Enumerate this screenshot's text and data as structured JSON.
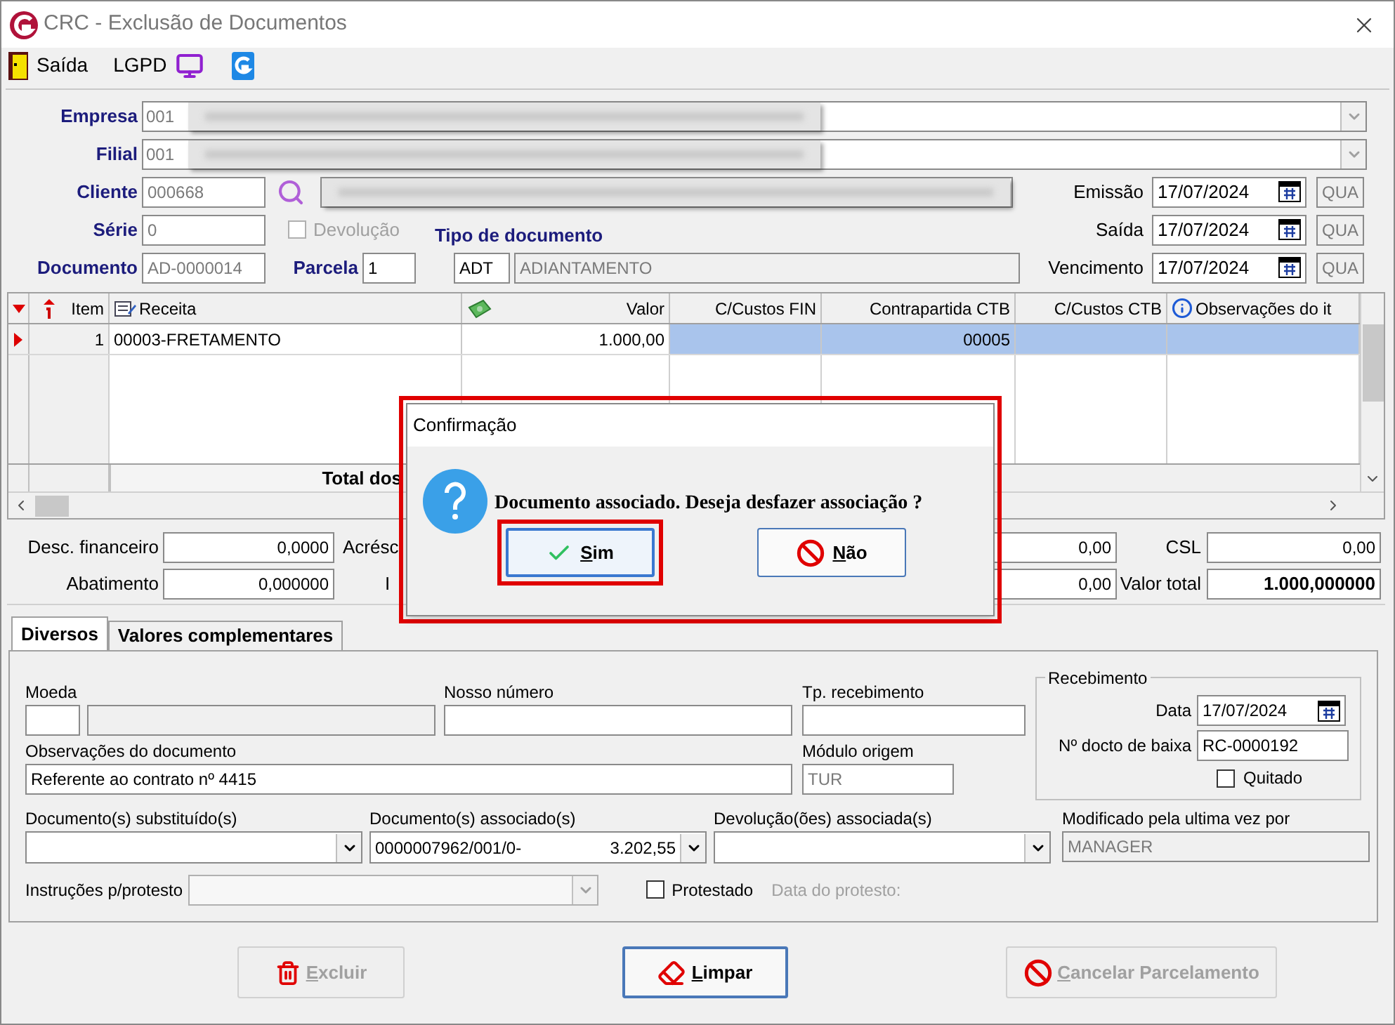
{
  "window": {
    "title": "CRC - Exclusão de Documentos"
  },
  "toolbar": [
    {
      "kind": "exit",
      "label": "Saída"
    },
    {
      "kind": "text",
      "label": "LGPD"
    },
    {
      "kind": "monitor"
    },
    {
      "kind": "logo"
    }
  ],
  "header": {
    "empresa": {
      "label": "Empresa",
      "code": "001"
    },
    "filial": {
      "label": "Filial",
      "code": "001"
    },
    "cliente": {
      "label": "Cliente",
      "code": "000668"
    },
    "serie": {
      "label": "Série",
      "value": "0"
    },
    "devolucao": {
      "label": "Devolução",
      "checked": false,
      "disabled": true
    },
    "documento": {
      "label": "Documento",
      "value": "AD-0000014"
    },
    "parcela": {
      "label": "Parcela",
      "value": "1"
    },
    "tipo": {
      "label": "Tipo de documento",
      "code": "ADT",
      "description": "ADIANTAMENTO"
    },
    "dates": [
      {
        "label": "Emissão",
        "value": "17/07/2024",
        "weekday": "QUA"
      },
      {
        "label": "Saída",
        "value": "17/07/2024",
        "weekday": "QUA"
      },
      {
        "label": "Vencimento",
        "value": "17/07/2024",
        "weekday": "QUA"
      }
    ]
  },
  "grid": {
    "columns": [
      {
        "label": "Item"
      },
      {
        "label": "Receita"
      },
      {
        "label": "Valor"
      },
      {
        "label": "C/Custos FIN"
      },
      {
        "label": "Contrapartida CTB"
      },
      {
        "label": "C/Custos CTB"
      },
      {
        "label": "Observações do it"
      }
    ],
    "rows": [
      {
        "selected": true,
        "cells": [
          "1",
          "00003-FRETAMENTO",
          "1.000,00",
          "",
          "00005",
          "",
          ""
        ]
      }
    ],
    "total_label": "Total dos"
  },
  "totals": [
    {
      "left": {
        "label": "Desc. financeiro",
        "value": "0,0000"
      },
      "cut_label": "Acrésc",
      "mid_value": "0,00",
      "right": {
        "label": "CSL",
        "value": "0,00",
        "bold": false
      }
    },
    {
      "left": {
        "label": "Abatimento",
        "value": "0,000000"
      },
      "cut_label": "I",
      "mid_value": "0,00",
      "right": {
        "label": "Valor total",
        "value": "1.000,000000",
        "bold": true
      }
    }
  ],
  "tabs": [
    {
      "label": "Diversos",
      "selected": true
    },
    {
      "label": "Valores complementares",
      "selected": false
    }
  ],
  "diversos": {
    "moeda": {
      "label": "Moeda"
    },
    "nosso_numero": {
      "label": "Nosso número"
    },
    "tp_recebimento": {
      "label": "Tp. recebimento"
    },
    "observacoes": {
      "label": "Observações do documento",
      "value": "Referente ao contrato nº 4415"
    },
    "modulo_origem": {
      "label": "Módulo origem",
      "value": "TUR"
    },
    "recebimento": {
      "title": "Recebimento",
      "data_label": "Data",
      "data_value": "17/07/2024",
      "baixa_label": "Nº docto de baixa",
      "baixa_value": "RC-0000192",
      "quitado": {
        "label": "Quitado",
        "checked": false
      }
    },
    "combos": [
      {
        "label": "Documento(s) substituído(s)"
      },
      {
        "label": "Documento(s) associado(s)",
        "value": "0000007962/001/0-",
        "amount": "3.202,55"
      },
      {
        "label": "Devolução(ões) associada(s)"
      }
    ],
    "modificado": {
      "label": "Modificado pela ultima vez por",
      "value": "MANAGER"
    },
    "instrucoes": {
      "label": "Instruções p/protesto",
      "disabled": true
    },
    "protestado": {
      "label": "Protestado",
      "checked": false
    },
    "data_protesto": {
      "label": "Data do protesto:",
      "disabled": true
    }
  },
  "buttons": [
    {
      "kind": "delete",
      "label": "Excluir",
      "disabled": true
    },
    {
      "kind": "clear",
      "label": "Limpar",
      "disabled": false
    },
    {
      "kind": "cancel",
      "label": "Cancelar Parcelamento",
      "disabled": true
    }
  ],
  "dialog": {
    "title": "Confirmação",
    "message": "Documento associado. Deseja desfazer associação ?",
    "highlighted": true,
    "buttons": [
      {
        "kind": "yes",
        "label": "Sim",
        "highlighted": true
      },
      {
        "kind": "no",
        "label": "Não",
        "highlighted": false
      }
    ]
  }
}
